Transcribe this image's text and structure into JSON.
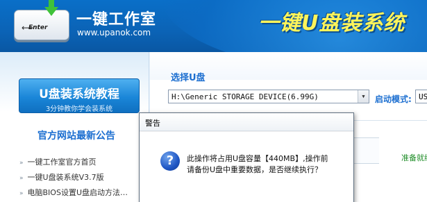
{
  "header": {
    "logo_key_label": "Enter",
    "logo_key_arrow": "⟵",
    "brand_title": "一键工作室",
    "brand_url": "www.upanok.com",
    "slogan": "一键U盘装系统"
  },
  "sidebar": {
    "tutorial_title": "U盘装系统教程",
    "tutorial_subtitle": "3分钟教你学会装系统",
    "news_title": "官方网站最新公告",
    "news_items": [
      "一键工作室官方首页",
      "一键U盘装系统V3.7版",
      "电脑BIOS设置U盘启动方法…"
    ]
  },
  "main": {
    "select_title": "选择U盘",
    "device_value": "H:\\Generic STORAGE DEVICE(6.99G)",
    "mode_label": "启动模式:",
    "mode_value": "US",
    "status_text": "准备就绪"
  },
  "dialog": {
    "title": "警告",
    "message_line1": "此操作将占用U盘容量【440MB】,操作前",
    "message_line2": "请备份U盘中重要数据，是否继续执行？",
    "icon": "question-icon"
  },
  "colors": {
    "header_blue": "#0b63b6",
    "accent_blue": "#1b6ed0",
    "slogan_yellow": "#fff45a",
    "status_green": "#1f8d28"
  }
}
